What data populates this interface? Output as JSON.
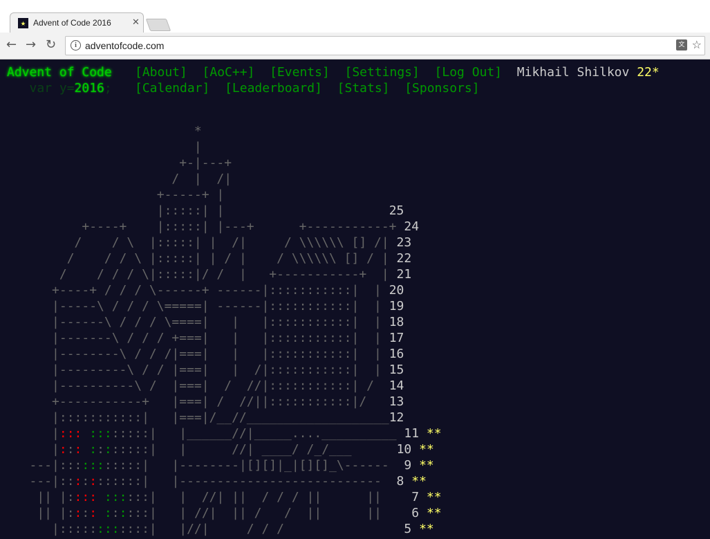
{
  "browser": {
    "tab_title": "Advent of Code 2016",
    "tab_favicon": "★",
    "tab_close": "✕",
    "url": "adventofcode.com",
    "nav": {
      "back": "←",
      "forward": "→",
      "reload": "↻"
    },
    "info_glyph": "i",
    "translate_glyph": "文",
    "bookmark_glyph": "☆"
  },
  "header": {
    "title": "Advent of Code",
    "year_prefix": "var y=",
    "year": "2016",
    "year_suffix": ";",
    "nav_row1": [
      "[About]",
      "[AoC++]",
      "[Events]",
      "[Settings]",
      "[Log Out]"
    ],
    "nav_row2": [
      "[Calendar]",
      "[Leaderboard]",
      "[Stats]",
      "[Sponsors]"
    ],
    "user_name": "Mikhail Shilkov",
    "user_stars": "22*"
  },
  "calendar": {
    "top": [
      "                         *",
      "                         |",
      "                       +-|---+",
      "                      /  |  /|",
      "                    +-----+ |"
    ],
    "rows": [
      {
        "segs": [
          [
            "                    |:::::| |                      ",
            ""
          ]
        ],
        "day": "25",
        "stars": ""
      },
      {
        "segs": [
          [
            "          +----+    |:::::| |---+      +-----------+ ",
            ""
          ]
        ],
        "day": "24",
        "stars": ""
      },
      {
        "segs": [
          [
            "         /    / \\  |:::::| |  /|     / \\\\\\\\\\\\ [] /| ",
            ""
          ]
        ],
        "day": "23",
        "stars": ""
      },
      {
        "segs": [
          [
            "        /    / / \\ |:::::| | / |    / \\\\\\\\\\\\ [] / | ",
            ""
          ]
        ],
        "day": "22",
        "stars": ""
      },
      {
        "segs": [
          [
            "       /    / / / \\|:::::|/ /  |   +-----------+  | ",
            ""
          ]
        ],
        "day": "21",
        "stars": ""
      },
      {
        "segs": [
          [
            "      +----+ / / / \\------+ ------|:::::::::::|  | ",
            ""
          ]
        ],
        "day": "20",
        "stars": ""
      },
      {
        "segs": [
          [
            "      |-----\\ / / / \\=====| ------|:::::::::::|  | ",
            ""
          ]
        ],
        "day": "19",
        "stars": ""
      },
      {
        "segs": [
          [
            "      |------\\ / / / \\====|   |   |:::::::::::|  | ",
            ""
          ]
        ],
        "day": "18",
        "stars": ""
      },
      {
        "segs": [
          [
            "      |-------\\ / / / +===|   |   |:::::::::::|  | ",
            ""
          ]
        ],
        "day": "17",
        "stars": ""
      },
      {
        "segs": [
          [
            "      |--------\\ / / /|===|   |   |:::::::::::|  | ",
            ""
          ]
        ],
        "day": "16",
        "stars": ""
      },
      {
        "segs": [
          [
            "      |---------\\ / / |===|   |  /|:::::::::::|  | ",
            ""
          ]
        ],
        "day": "15",
        "stars": ""
      },
      {
        "segs": [
          [
            "      |----------\\ /  |===|  /  //|:::::::::::| /  ",
            ""
          ]
        ],
        "day": "14",
        "stars": ""
      },
      {
        "segs": [
          [
            "      +-----------+   |===| /  //||:::::::::::|/   ",
            ""
          ]
        ],
        "day": "13",
        "stars": ""
      },
      {
        "segs": [
          [
            "      |:::::::::::|   |===|/__//___________________",
            ""
          ]
        ],
        "day": "12",
        "stars": ""
      },
      {
        "segs": [
          [
            "      |",
            ""
          ],
          [
            ":::",
            "red"
          ],
          [
            " ",
            ""
          ],
          [
            ":::",
            "grn"
          ],
          [
            ":::::|   |______//|_____....__________ ",
            ""
          ]
        ],
        "day": "11",
        "stars": "**"
      },
      {
        "segs": [
          [
            "      |",
            ""
          ],
          [
            ":",
            "red"
          ],
          [
            ":",
            ""
          ],
          [
            ":",
            "red"
          ],
          [
            " ",
            ""
          ],
          [
            ":",
            "grn"
          ],
          [
            ":",
            ""
          ],
          [
            ":",
            "grn"
          ],
          [
            ":::::|   |      //| ____/ /_/___      ",
            ""
          ]
        ],
        "day": "10",
        "stars": "**"
      },
      {
        "segs": [
          [
            "   ---|:::",
            ""
          ],
          [
            ":::",
            "grn"
          ],
          [
            ":::::|   |--------|[][]|_|[][]_\\------ ",
            ""
          ]
        ],
        "day": " 9",
        "stars": "**"
      },
      {
        "segs": [
          [
            "   ---|::",
            ""
          ],
          [
            ":",
            "red"
          ],
          [
            ":",
            ""
          ],
          [
            ":",
            "red"
          ],
          [
            "::::::|   |--------------------------- ",
            ""
          ]
        ],
        "day": " 8",
        "stars": "**"
      },
      {
        "segs": [
          [
            "    || |:",
            ""
          ],
          [
            ":::",
            "red"
          ],
          [
            " ",
            ""
          ],
          [
            ":::",
            "grn"
          ],
          [
            ":::|   |  //| ||  / / / ||      ||   ",
            ""
          ]
        ],
        "day": " 7",
        "stars": "**"
      },
      {
        "segs": [
          [
            "    || |:",
            ""
          ],
          [
            ":",
            "red"
          ],
          [
            ":",
            ""
          ],
          [
            ":",
            "red"
          ],
          [
            " ",
            ""
          ],
          [
            ":",
            "grn"
          ],
          [
            ":",
            ""
          ],
          [
            ":",
            "grn"
          ],
          [
            ":::|   | //|  || /   /  ||      ||   ",
            ""
          ]
        ],
        "day": " 6",
        "stars": "**"
      },
      {
        "segs": [
          [
            "      |:::::",
            ""
          ],
          [
            ":::",
            "grn"
          ],
          [
            "::::|   |//|     / / /               ",
            ""
          ]
        ],
        "day": " 5",
        "stars": "**"
      }
    ]
  }
}
